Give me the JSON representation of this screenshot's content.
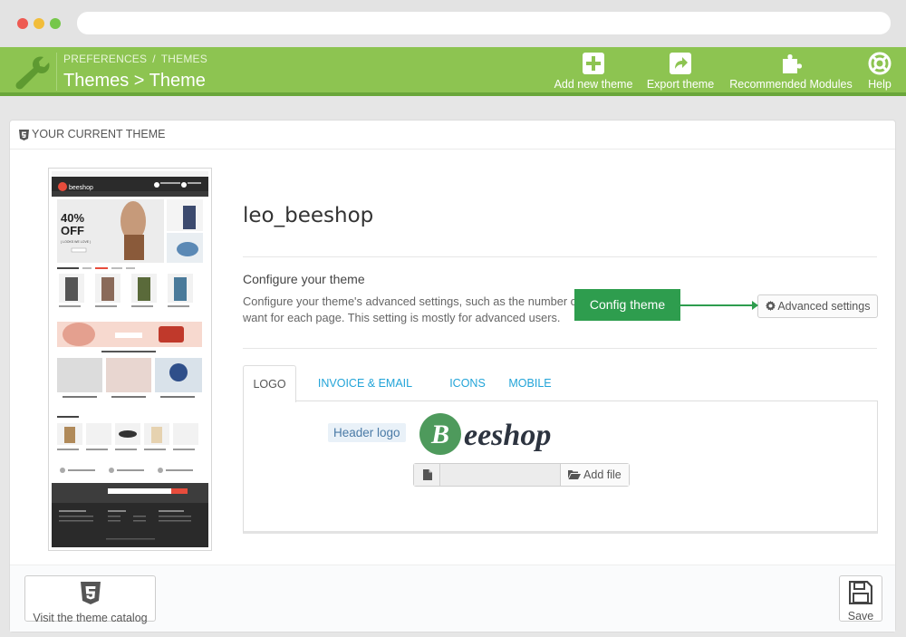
{
  "toolbar": {
    "breadcrumb": [
      "PREFERENCES",
      "THEMES"
    ],
    "breadcrumb_sep": "/",
    "title": "Themes > Theme",
    "buttons": [
      {
        "label": "Add new theme",
        "icon": "plus-icon"
      },
      {
        "label": "Export theme",
        "icon": "export-icon"
      },
      {
        "label": "Recommended Modules",
        "icon": "puzzle-icon"
      },
      {
        "label": "Help",
        "icon": "lifebuoy-icon"
      }
    ]
  },
  "panel": {
    "heading": "YOUR CURRENT THEME",
    "theme_name": "leo_beeshop",
    "configure_title": "Configure your theme",
    "configure_desc": "Configure your theme's advanced settings, such as the number of want for each page. This setting is mostly for advanced users.",
    "advanced_button": "Advanced settings",
    "callout": "Config theme",
    "tabs": [
      "LOGO",
      "INVOICE & EMAIL LOGOS",
      "ICONS",
      "MOBILE"
    ],
    "active_tab": "LOGO",
    "header_logo_label": "Header logo",
    "logo_text": "eeshop",
    "logo_letter": "B",
    "add_file_button": "Add file",
    "footer_catalog_button": "Visit the theme catalog",
    "footer_save_button": "Save"
  },
  "thumbnail": {
    "banner_big": "40%",
    "banner_off": "OFF",
    "banner_sub": "( LOOKS WE LOVE )",
    "brand": "beeshop"
  },
  "colors": {
    "toolbar_green": "#8dc451",
    "callout_green": "#2e9d4e",
    "link_blue": "#22a4d8",
    "logo_green": "#4e9a5c"
  }
}
